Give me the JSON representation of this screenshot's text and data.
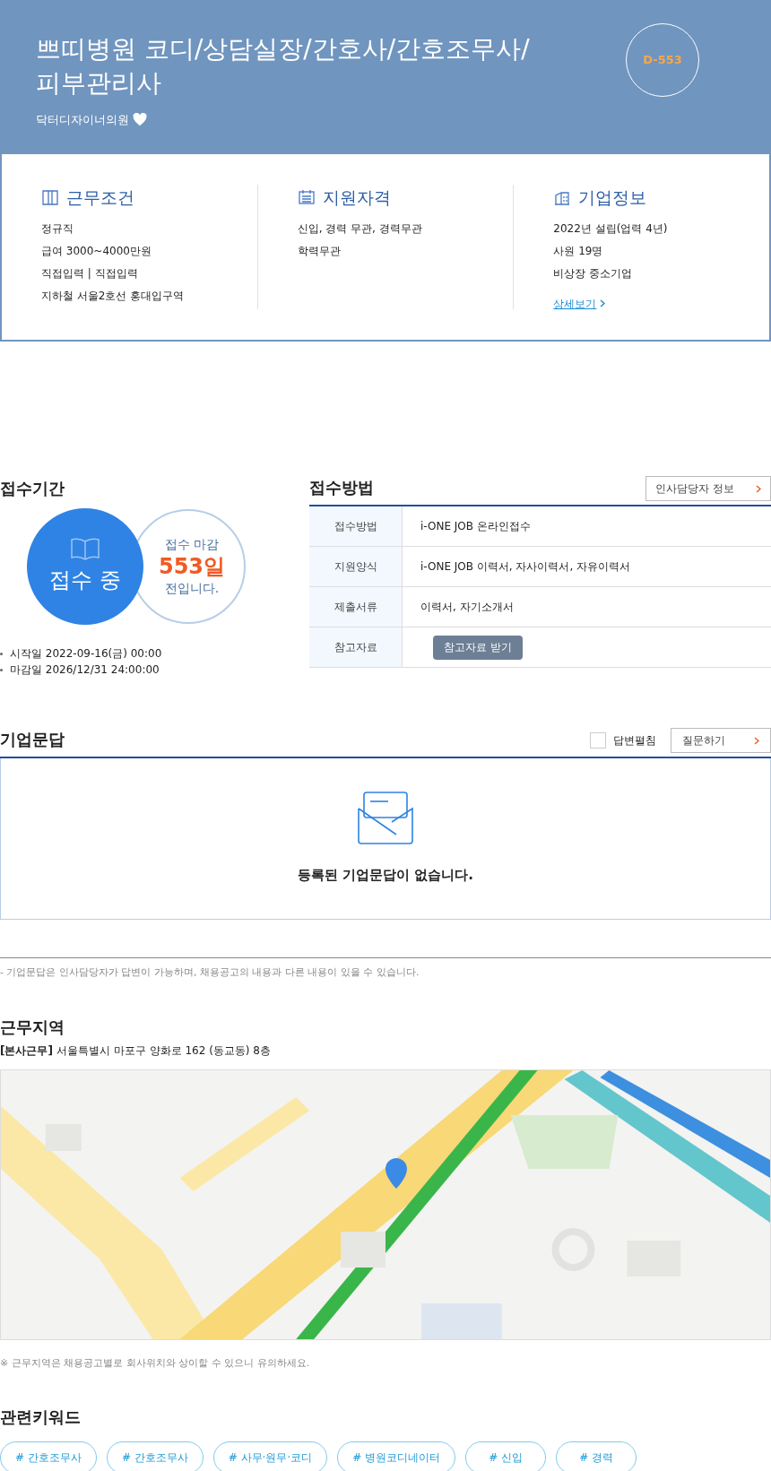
{
  "header": {
    "title": "쁘띠병원 코디/상담실장/간호사/간호조무사/피부관리사",
    "company": "닥터디자이너의원",
    "favorite": false,
    "dday": "D-553"
  },
  "summary": [
    {
      "kind": "work",
      "title": "근무조건",
      "lines": [
        "정규직",
        "급여 3000~4000만원",
        "직접입력 | 직접입력",
        "지하철 서울2호선 홍대입구역"
      ]
    },
    {
      "kind": "qual",
      "title": "지원자격",
      "lines": [
        "신입, 경력 무관, 경력무관",
        "학력무관"
      ]
    },
    {
      "kind": "company",
      "title": "기업정보",
      "lines": [
        "2022년 설립(업력 4년)",
        "사원 19명",
        "비상장 중소기업"
      ],
      "link": "상세보기"
    }
  ],
  "period": {
    "title": "접수기간",
    "status": "접수 중",
    "deadline_top": "접수 마감",
    "deadline_days": "553일",
    "deadline_bottom": "전입니다.",
    "dates": [
      "시작일 2022-09-16(금) 00:00",
      "마감일 2026/12/31 24:00:00"
    ]
  },
  "method": {
    "title": "접수방법",
    "hr_button": "인사담당자 정보",
    "rows": [
      {
        "label": "접수방법",
        "value": "i-ONE JOB 온라인접수"
      },
      {
        "label": "지원양식",
        "value": "i-ONE JOB 이력서, 자사이력서, 자유이력서"
      },
      {
        "label": "제출서류",
        "value": "이력서, 자기소개서"
      },
      {
        "label": "참고자료",
        "button": "참고자료 받기"
      }
    ]
  },
  "qna": {
    "title": "기업문답",
    "expand_label": "답변펼침",
    "expand_checked": false,
    "ask_button": "질문하기",
    "empty": "등록된 기업문답이 없습니다.",
    "note": "- 기업문답은 인사담당자가 답변이 가능하며, 채용공고의 내용과 다른 내용이 있을 수 있습니다."
  },
  "location": {
    "title": "근무지역",
    "tag": "[본사근무]",
    "address": "서울특별시 마포구 양화로 162 (동교동) 8층",
    "note": "※ 근무지역은 채용공고별로 회사위치와 상이할 수 있으니 유의하세요."
  },
  "keywords": {
    "title": "관련키워드",
    "items": [
      "# 간호조무사",
      "# 간호조무사",
      "# 사무·원무·코디",
      "# 병원코디네이터",
      "# 신입",
      "# 경력"
    ]
  }
}
